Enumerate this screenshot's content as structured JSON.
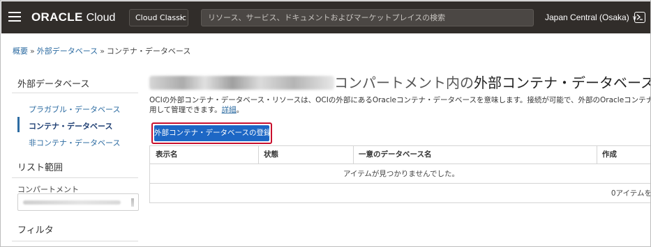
{
  "header": {
    "brand": "ORACLE",
    "brand_suffix": "Cloud",
    "classic_label": "Cloud Classic",
    "search_placeholder": "リソース、サービス、ドキュメントおよびマーケットプレイスの検索",
    "region": "Japan Central (Osaka)"
  },
  "breadcrumb": {
    "items": [
      "概要",
      "外部データベース"
    ],
    "separator": "»",
    "current": "コンテナ・データベース"
  },
  "sidebar": {
    "section_title": "外部データベース",
    "items": [
      {
        "label": "プラガブル・データベース",
        "active": false
      },
      {
        "label": "コンテナ・データベース",
        "active": true
      },
      {
        "label": "非コンテナ・データベース",
        "active": false
      }
    ],
    "scope_title": "リスト範囲",
    "compartment_label": "コンパートメント",
    "filter_title": "フィルタ"
  },
  "main": {
    "title_middle": "コンパートメント内の",
    "title_strong": "外部コンテナ・データベース",
    "description_line1": "OCIの外部コンテナ・データベース・リソースは、OCIの外部にあるOracleコンテナ・データベースを意味します。接続が可能で、外部のOracleコンテナ・データベース",
    "description_line2": "用して管理できます。",
    "details_link": "詳細",
    "description_end": "。",
    "create_button": "外部コンテナ・データベースの登録",
    "table": {
      "columns": [
        "表示名",
        "状態",
        "一意のデータベース名",
        "作成"
      ],
      "empty_message": "アイテムが見つかりませんでした。",
      "count_text": "0アイテムを"
    }
  },
  "colors": {
    "topbar": "#312d2a",
    "link": "#2d6ca2",
    "primary_button": "#1d67c5",
    "highlight_outline": "#c8102e"
  }
}
